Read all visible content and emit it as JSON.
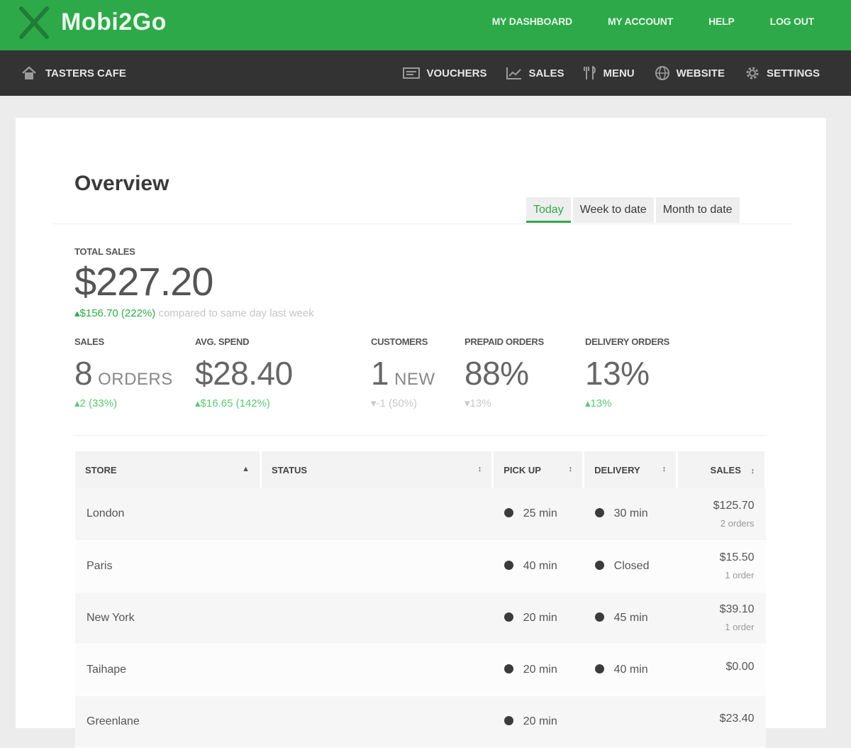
{
  "brand": {
    "name": "Mobi2Go",
    "color": "#2ea94a"
  },
  "top_nav": [
    "MY DASHBOARD",
    "MY ACCOUNT",
    "HELP",
    "LOG OUT"
  ],
  "store_name": "TASTERS CAFE",
  "sub_nav": [
    "VOUCHERS",
    "SALES",
    "MENU",
    "WEBSITE",
    "SETTINGS"
  ],
  "overview": {
    "title": "Overview",
    "tabs": [
      "Today",
      "Week to date",
      "Month to date"
    ],
    "active_tab": "Today"
  },
  "total_sales": {
    "label": "TOTAL SALES",
    "value": "$227.20",
    "change": "▴$156.70 (222%)",
    "change_note": "compared to same day last week"
  },
  "metrics": [
    {
      "label": "SALES",
      "value": "8",
      "suffix": "ORDERS",
      "change": "▴2 (33%)",
      "direction": "up"
    },
    {
      "label": "AVG. SPEND",
      "value": "$28.40",
      "suffix": "",
      "change": "▴$16.65 (142%)",
      "direction": "up"
    },
    {
      "label": "CUSTOMERS",
      "value": "1",
      "suffix": "NEW",
      "change": "▾-1 (50%)",
      "direction": "down"
    },
    {
      "label": "PREPAID ORDERS",
      "value": "88%",
      "suffix": "",
      "change": "▾13%",
      "direction": "down"
    },
    {
      "label": "DELIVERY ORDERS",
      "value": "13%",
      "suffix": "",
      "change": "▴13%",
      "direction": "up"
    }
  ],
  "table": {
    "columns": [
      "STORE",
      "STATUS",
      "PICK UP",
      "DELIVERY",
      "SALES"
    ],
    "sort_icons": [
      "▲",
      "↕",
      "↕",
      "↕",
      "↕"
    ],
    "rows": [
      {
        "store": "London",
        "status": "",
        "pickup": "25 min",
        "delivery": "30 min",
        "sales": "$125.70",
        "orders": "2 orders"
      },
      {
        "store": "Paris",
        "status": "",
        "pickup": "40 min",
        "delivery": "Closed",
        "sales": "$15.50",
        "orders": "1 order"
      },
      {
        "store": "New York",
        "status": "",
        "pickup": "20 min",
        "delivery": "45 min",
        "sales": "$39.10",
        "orders": "1 order"
      },
      {
        "store": "Taihape",
        "status": "",
        "pickup": "20 min",
        "delivery": "40 min",
        "sales": "$0.00",
        "orders": ""
      },
      {
        "store": "Greenlane",
        "status": "",
        "pickup": "20 min",
        "delivery": "",
        "sales": "$23.40",
        "orders": ""
      }
    ]
  },
  "icons": [
    "home-icon",
    "vouchers-icon",
    "sales-chart-icon",
    "menu-cutlery-icon",
    "website-globe-icon",
    "settings-gear-icon",
    "clock-icon"
  ]
}
